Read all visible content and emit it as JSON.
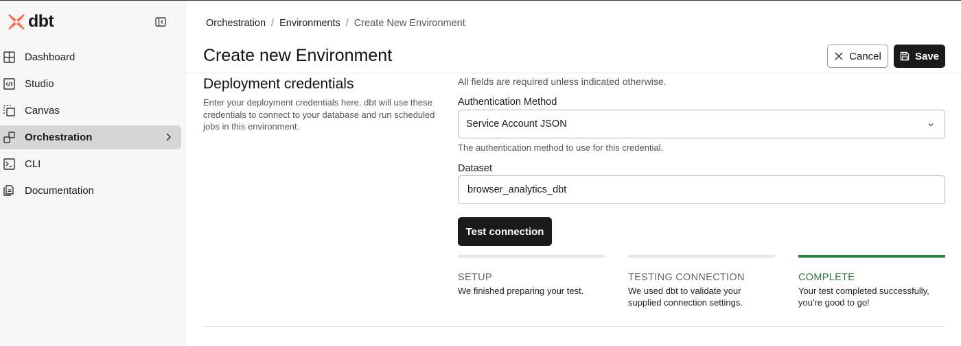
{
  "brand": {
    "name": "dbt",
    "accent": "#ff694a"
  },
  "sidebar": {
    "items": [
      {
        "label": "Dashboard",
        "icon": "dashboard-icon"
      },
      {
        "label": "Studio",
        "icon": "code-icon"
      },
      {
        "label": "Canvas",
        "icon": "canvas-icon"
      },
      {
        "label": "Orchestration",
        "icon": "orchestration-icon",
        "active": true
      },
      {
        "label": "CLI",
        "icon": "terminal-icon"
      },
      {
        "label": "Documentation",
        "icon": "documentation-icon"
      }
    ]
  },
  "breadcrumb": {
    "items": [
      "Orchestration",
      "Environments"
    ],
    "current": "Create New Environment",
    "separator": "/"
  },
  "header": {
    "title": "Create new Environment",
    "cancel_label": "Cancel",
    "save_label": "Save"
  },
  "section": {
    "title": "Deployment credentials",
    "description": "Enter your deployment credentials here. dbt will use these credentials to connect to your database and run scheduled jobs in this environment."
  },
  "form": {
    "required_note": "All fields are required unless indicated otherwise.",
    "auth_method": {
      "label": "Authentication Method",
      "value": "Service Account JSON",
      "help": "The authentication method to use for this credential."
    },
    "dataset": {
      "label": "Dataset",
      "value": "browser_analytics_dbt"
    },
    "test_button_label": "Test connection"
  },
  "steps": [
    {
      "title": "SETUP",
      "description": "We finished preparing your test.",
      "state": "done"
    },
    {
      "title": "TESTING CONNECTION",
      "description": "We used dbt to validate your supplied connection settings.",
      "state": "done"
    },
    {
      "title": "COMPLETE",
      "description": "Your test completed successfully, you're good to go!",
      "state": "complete"
    }
  ],
  "colors": {
    "success": "#2b7d3a",
    "primary_button": "#1a1a1a"
  }
}
